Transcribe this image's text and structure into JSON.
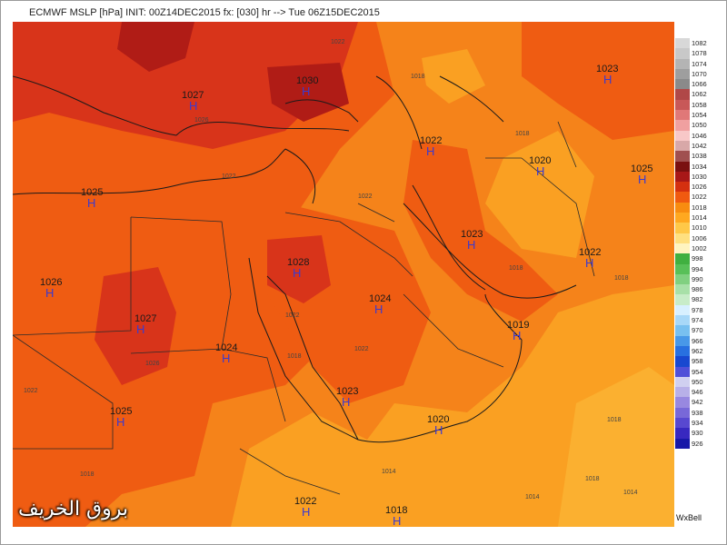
{
  "title": "ECMWF MSLP [hPa] INIT: 00Z14DEC2015 fx: [030] hr --> Tue 06Z15DEC2015",
  "brand": "WxBell",
  "watermark": "بروق الخريف",
  "legend": {
    "levels": [
      "1082",
      "1078",
      "1074",
      "1070",
      "1066",
      "1062",
      "1058",
      "1054",
      "1050",
      "1046",
      "1042",
      "1038",
      "1034",
      "1030",
      "1026",
      "1022",
      "1018",
      "1014",
      "1010",
      "1006",
      "1002",
      "998",
      "994",
      "990",
      "986",
      "982",
      "978",
      "974",
      "970",
      "966",
      "962",
      "958",
      "954",
      "950",
      "946",
      "942",
      "938",
      "934",
      "930",
      "926"
    ],
    "colors": [
      "#d8d8d8",
      "#c8c8c8",
      "#b4b4b4",
      "#9e9e9e",
      "#8a8a8a",
      "#b04848",
      "#c85858",
      "#e07878",
      "#f0a0a0",
      "#f8c8c8",
      "#d8a8a8",
      "#a05050",
      "#7a1010",
      "#a81818",
      "#d43010",
      "#f05a10",
      "#f88c10",
      "#ffa820",
      "#ffc848",
      "#ffe080",
      "#fff4c0",
      "#40b040",
      "#58c058",
      "#80d080",
      "#a8e0a8",
      "#c8ecc8",
      "#d8f0ff",
      "#a8d8f8",
      "#78c0f0",
      "#4898e8",
      "#2870e0",
      "#1848d0",
      "#5050d8",
      "#d0d0f0",
      "#b8b0e8",
      "#9888e0",
      "#7868d8",
      "#5848d0",
      "#3828c0",
      "#1818a8"
    ]
  },
  "highs": [
    {
      "value": "1030",
      "label": "H"
    },
    {
      "value": "1027",
      "label": "H"
    },
    {
      "value": "1023",
      "label": "H"
    },
    {
      "value": "1022",
      "label": "H"
    },
    {
      "value": "1020",
      "label": "H"
    },
    {
      "value": "1025",
      "label": "H"
    },
    {
      "value": "1025",
      "label": "H"
    },
    {
      "value": "1026",
      "label": "H"
    },
    {
      "value": "1027",
      "label": "H"
    },
    {
      "value": "1028",
      "label": "H"
    },
    {
      "value": "1024",
      "label": "H"
    },
    {
      "value": "1024",
      "label": "H"
    },
    {
      "value": "1023",
      "label": "H"
    },
    {
      "value": "1022",
      "label": "H"
    },
    {
      "value": "1019",
      "label": "H"
    },
    {
      "value": "1023",
      "label": "H"
    },
    {
      "value": "1020",
      "label": "H"
    },
    {
      "value": "1025",
      "label": "H"
    },
    {
      "value": "1022",
      "label": "H"
    },
    {
      "value": "1018",
      "label": "H"
    }
  ],
  "isobar_labels": [
    "1022",
    "1018",
    "1026",
    "1022",
    "1022",
    "1018",
    "1014",
    "1018",
    "1018",
    "1022",
    "1026",
    "1022",
    "1018",
    "1018",
    "1014",
    "1018",
    "1022",
    "1014",
    "1018"
  ]
}
